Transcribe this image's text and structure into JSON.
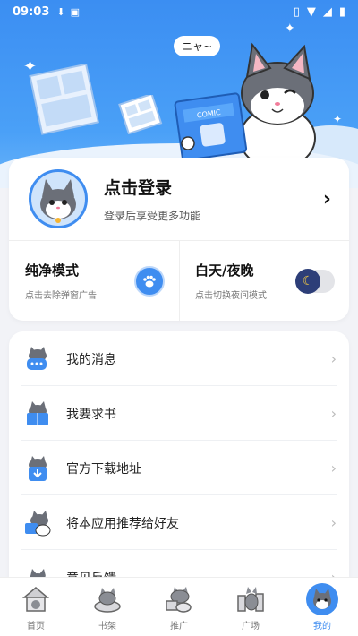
{
  "status_bar": {
    "time": "09:03"
  },
  "hero": {
    "speech": "ニャ~",
    "book_title": "COMIC"
  },
  "profile": {
    "title": "点击登录",
    "subtitle": "登录后享受更多功能"
  },
  "toggles": [
    {
      "title": "纯净模式",
      "subtitle": "点击去除弹窗广告",
      "icon": "paw-icon"
    },
    {
      "title": "白天/夜晚",
      "subtitle": "点击切换夜间模式",
      "icon": "moon-icon"
    }
  ],
  "menu": {
    "items": [
      {
        "label": "我的消息",
        "icon": "message-cat-icon"
      },
      {
        "label": "我要求书",
        "icon": "book-cat-icon"
      },
      {
        "label": "官方下载地址",
        "icon": "download-cat-icon"
      },
      {
        "label": "将本应用推荐给好友",
        "icon": "share-cat-icon"
      },
      {
        "label": "意见反馈",
        "icon": "feedback-cat-icon"
      }
    ]
  },
  "bottom_nav": {
    "items": [
      {
        "label": "首页",
        "icon": "home-icon"
      },
      {
        "label": "书架",
        "icon": "bookshelf-icon"
      },
      {
        "label": "推广",
        "icon": "promote-icon"
      },
      {
        "label": "广场",
        "icon": "plaza-icon"
      },
      {
        "label": "我的",
        "icon": "profile-icon",
        "active": true
      }
    ]
  },
  "colors": {
    "accent": "#3f8df0",
    "hero_top": "#3b8ef2",
    "night_knob": "#2d3e78"
  }
}
